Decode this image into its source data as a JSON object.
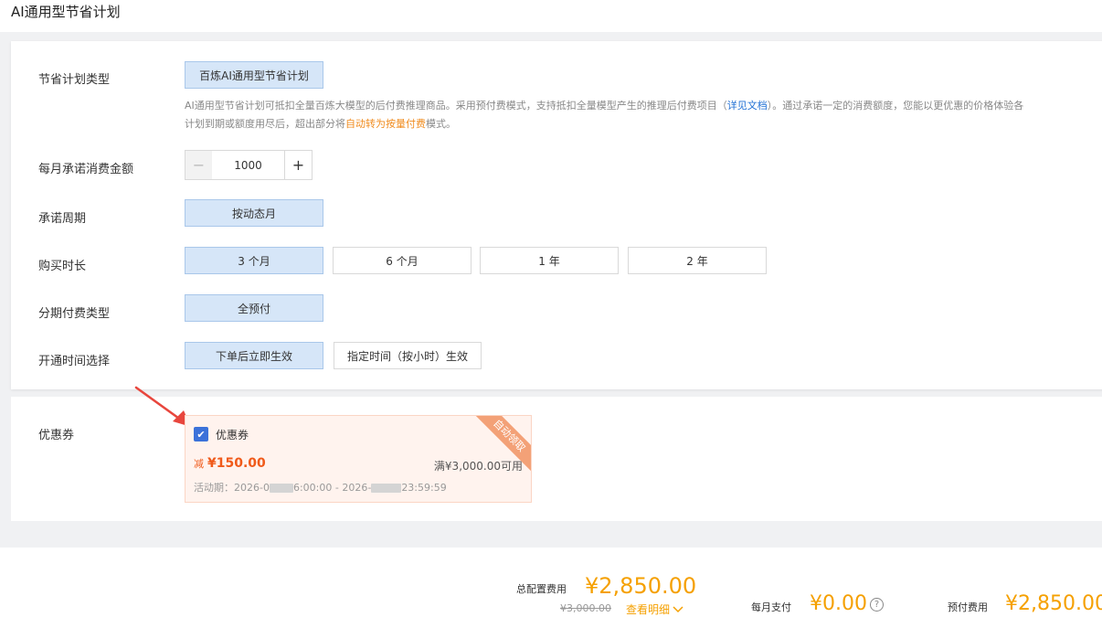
{
  "page": {
    "title": "AI通用型节省计划"
  },
  "plan_type": {
    "label": "节省计划类型",
    "option": "百炼AI通用型节省计划",
    "desc_line1_prefix": "AI通用型节省计划可抵扣全量百炼大模型的后付费推理商品。采用预付费模式，支持抵扣全量模型产生的推理后付费项目（",
    "desc_link": "详见文档",
    "desc_line1_suffix": "）。通过承诺一定的消费额度，您能以更优惠的价格体验各",
    "desc_line2_prefix": "计划到期或额度用尽后，超出部分将",
    "desc_line2_highlight": "自动转为按量付费",
    "desc_line2_suffix": "模式。"
  },
  "monthly_amount": {
    "label": "每月承诺消费金额",
    "value": "1000",
    "minus": "−",
    "plus": "+"
  },
  "commit_period": {
    "label": "承诺周期",
    "option": "按动态月"
  },
  "duration": {
    "label": "购买时长",
    "options": [
      "3 个月",
      "6 个月",
      "1 年",
      "2 年"
    ],
    "selected": "3 个月"
  },
  "payment_type": {
    "label": "分期付费类型",
    "option": "全预付"
  },
  "activation": {
    "label": "开通时间选择",
    "options": [
      "下单后立即生效",
      "指定时间（按小时）生效"
    ],
    "selected": "下单后立即生效"
  },
  "coupon": {
    "label": "优惠券",
    "checkbox_label": "优惠券",
    "checked": true,
    "ribbon": "自动领取",
    "discount_prefix": "减",
    "discount_amount": "¥150.00",
    "condition": "满¥3,000.00可用",
    "period_prefix": "活动期：2026-0",
    "period_mid": "6:00:00 - 2026-",
    "period_end": "23:59:59"
  },
  "footer": {
    "total_label": "总配置费用",
    "total_amount": "¥2,850.00",
    "original_amount": "¥3,000.00",
    "details_link": "查看明细",
    "monthly_label": "每月支付",
    "monthly_amount": "¥0.00",
    "prepay_label": "预付费用",
    "prepay_amount": "¥2,850.00"
  },
  "colors": {
    "accent": "#f5a000",
    "selected_bg": "#d6e6f8",
    "link": "#1f6fd4",
    "checkbox": "#3b72d9"
  }
}
